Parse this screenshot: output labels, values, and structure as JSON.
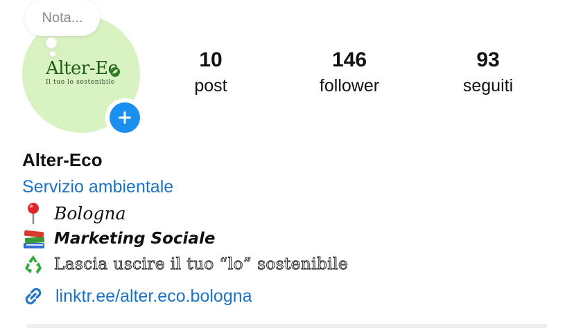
{
  "profile": {
    "note_placeholder": "Nota...",
    "avatar": {
      "logo_text": "Alter-Ec",
      "tagline": "Il tuo lo sostenibile",
      "background_color": "#d9f2c2"
    },
    "add_story_icon": "plus-icon"
  },
  "stats": {
    "posts": {
      "value": "10",
      "label": "post"
    },
    "followers": {
      "value": "146",
      "label": "follower"
    },
    "following": {
      "value": "93",
      "label": "seguiti"
    }
  },
  "bio": {
    "name": "Alter-Eco",
    "category": "Servizio ambientale",
    "lines": [
      {
        "icon": "pushpin-icon",
        "text": "Bologna"
      },
      {
        "icon": "books-icon",
        "text": "Marketing Sociale"
      },
      {
        "icon": "recycle-icon",
        "text": "Lascia uscire il tuo “lo” sostenibile"
      }
    ],
    "link": {
      "icon": "link-icon",
      "text": "linktr.ee/alter.eco.bologna"
    }
  },
  "colors": {
    "accent_link": "#1a73c8",
    "add_button": "#1a8ff0"
  }
}
